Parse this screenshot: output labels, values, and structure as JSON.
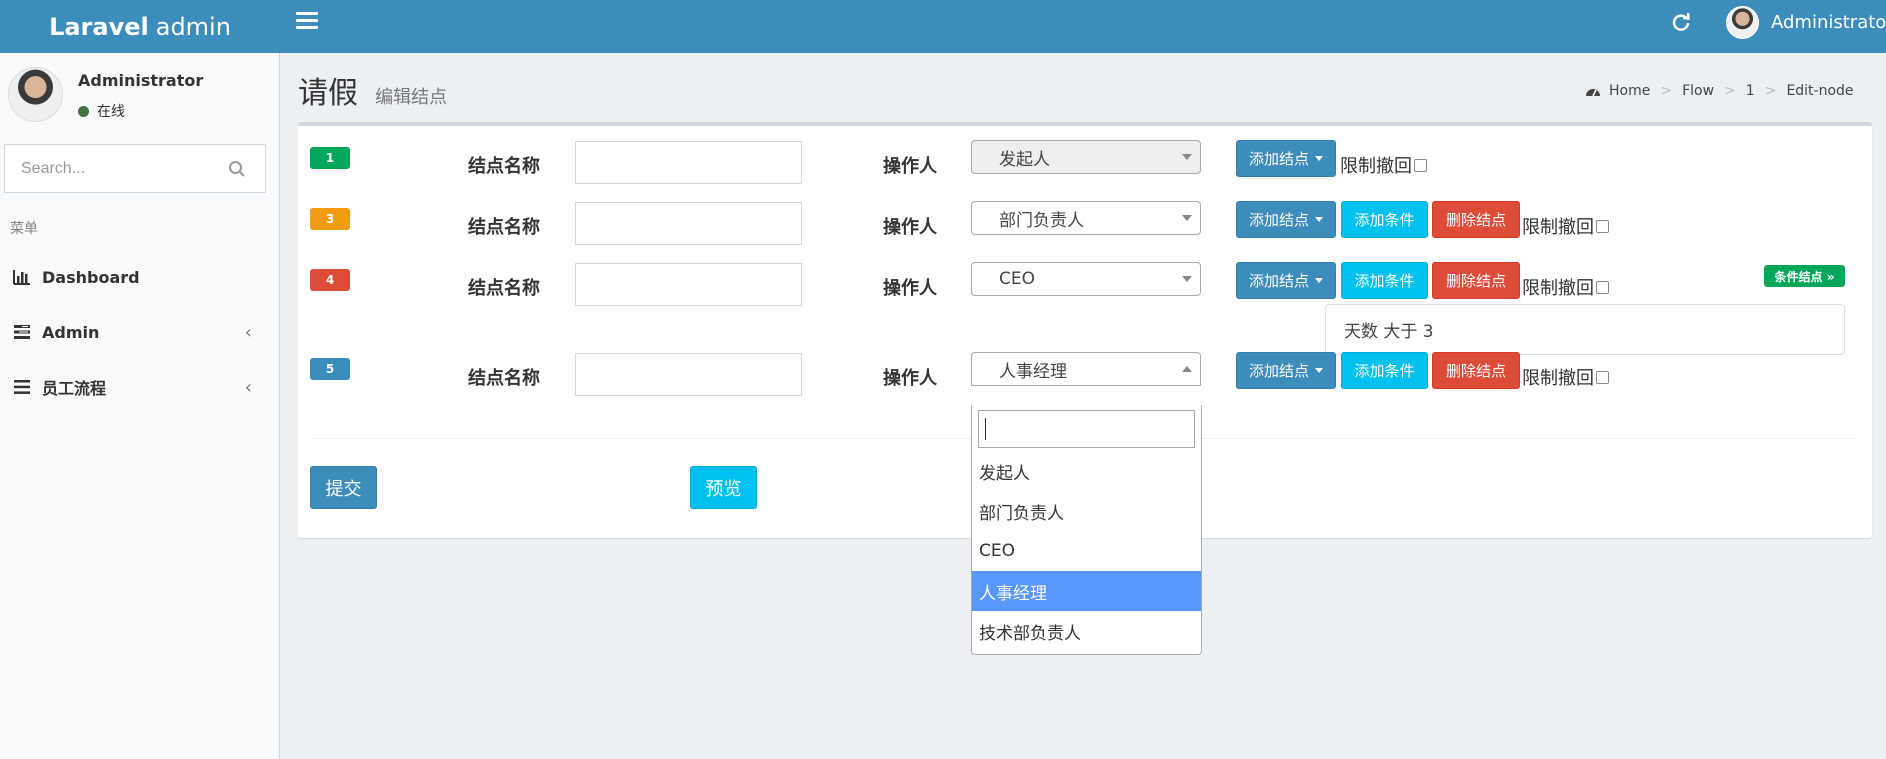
{
  "header": {
    "logo_bold": "Laravel",
    "logo_light": "admin",
    "user_name": "Administrator"
  },
  "sidebar": {
    "user_name": "Administrator",
    "user_status": "在线",
    "search_placeholder": "Search...",
    "menu_header": "菜单",
    "items": [
      {
        "label": "Dashboard",
        "icon": "bar-chart-icon"
      },
      {
        "label": "Admin",
        "icon": "tasks-icon",
        "chevron": "‹"
      },
      {
        "label": "员工流程",
        "icon": "bars-icon",
        "chevron": "‹"
      }
    ]
  },
  "page": {
    "title": "请假",
    "subtitle": "编辑结点"
  },
  "breadcrumb": [
    "Home",
    "Flow",
    "1",
    "Edit-node"
  ],
  "form": {
    "field_label": "结点名称",
    "operator_label": "操作人",
    "add_node_label": "添加结点",
    "add_condition_label": "添加条件",
    "delete_node_label": "删除结点",
    "limit_revoke_label": "限制撤回",
    "condition_node_label": "条件结点 »",
    "condition_text": "天数 大于 3",
    "rows": [
      {
        "badge": "1",
        "badge_color": "#00a65a",
        "operator": "发起人"
      },
      {
        "badge": "3",
        "badge_color": "#f39c12",
        "operator": "部门负责人"
      },
      {
        "badge": "4",
        "badge_color": "#dd4b39",
        "operator": "CEO"
      },
      {
        "badge": "5",
        "badge_color": "#3c8dbc",
        "operator": "人事经理"
      }
    ],
    "submit_label": "提交",
    "preview_label": "预览"
  },
  "dropdown": {
    "options": [
      "发起人",
      "部门负责人",
      "CEO",
      "人事经理",
      "技术部负责人"
    ],
    "selected": "人事经理"
  },
  "colors": {
    "primary": "#3c8dbc",
    "info": "#00c0ef",
    "danger": "#dd4b39",
    "success": "#00a65a",
    "warning": "#f39c12"
  }
}
